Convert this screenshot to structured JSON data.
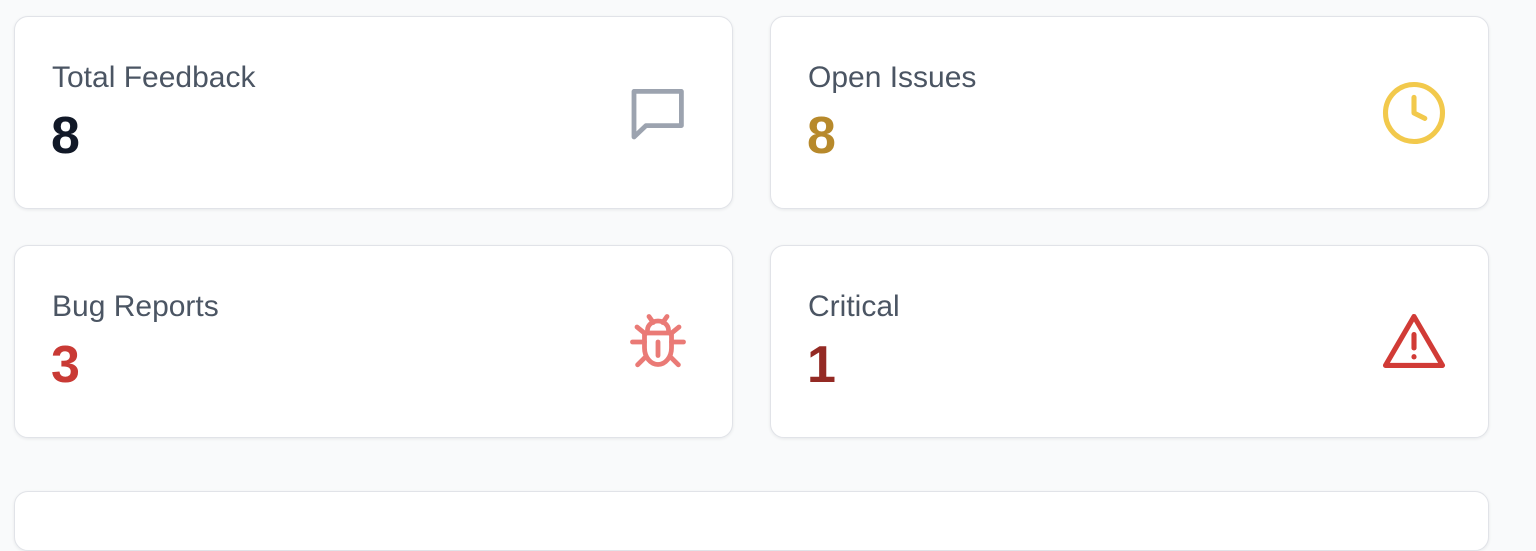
{
  "stats": [
    {
      "label": "Total Feedback",
      "value": "8",
      "icon": "message-square-icon",
      "value_color": "#111827",
      "icon_color": "#9ca3af"
    },
    {
      "label": "Open Issues",
      "value": "8",
      "icon": "clock-icon",
      "value_color": "#b7892b",
      "icon_color": "#f2c94c"
    },
    {
      "label": "Bug Reports",
      "value": "3",
      "icon": "bug-icon",
      "value_color": "#c93a35",
      "icon_color": "#ea7a76"
    },
    {
      "label": "Critical",
      "value": "1",
      "icon": "alert-triangle-icon",
      "value_color": "#942a24",
      "icon_color": "#d13b36"
    }
  ]
}
